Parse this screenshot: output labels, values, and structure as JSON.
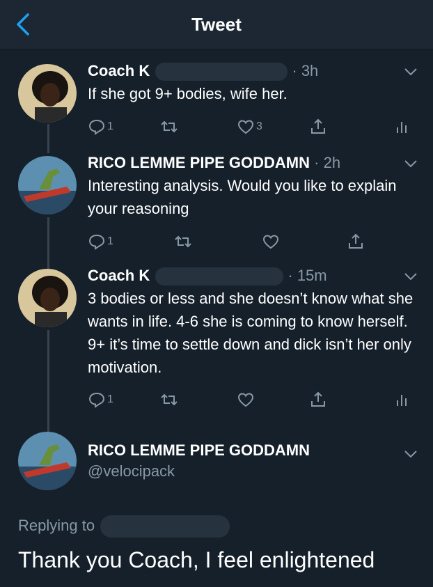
{
  "header": {
    "title": "Tweet"
  },
  "tweets": [
    {
      "name": "Coach K",
      "time": "· 3h",
      "text": "If she got 9+ bodies, wife her.",
      "replies": "1",
      "likes": "3"
    },
    {
      "name": "RICO LEMME PIPE GODDAMN",
      "time": "· 2h",
      "text": "Interesting analysis. Would you like to explain your reasoning",
      "replies": "1"
    },
    {
      "name": "Coach K",
      "time": "· 15m",
      "text": "3 bodies or less and she doesn’t know what she wants in life. 4-6 she is coming to know herself. 9+ it’s time to settle down and dick isn’t her only motivation.",
      "replies": "1"
    }
  ],
  "main_tweet": {
    "name": "RICO LEMME PIPE GODDAMN",
    "handle": "@velocipack",
    "replying_label": "Replying to",
    "text": "Thank you Coach, I feel enlightened"
  },
  "icons": [
    "back-icon",
    "chevron-down-icon",
    "reply-icon",
    "retweet-icon",
    "like-icon",
    "share-icon",
    "analytics-icon"
  ],
  "colors": {
    "background": "#15202b",
    "header": "#1c2733",
    "accent": "#1da1f2",
    "muted": "#8899a6"
  }
}
